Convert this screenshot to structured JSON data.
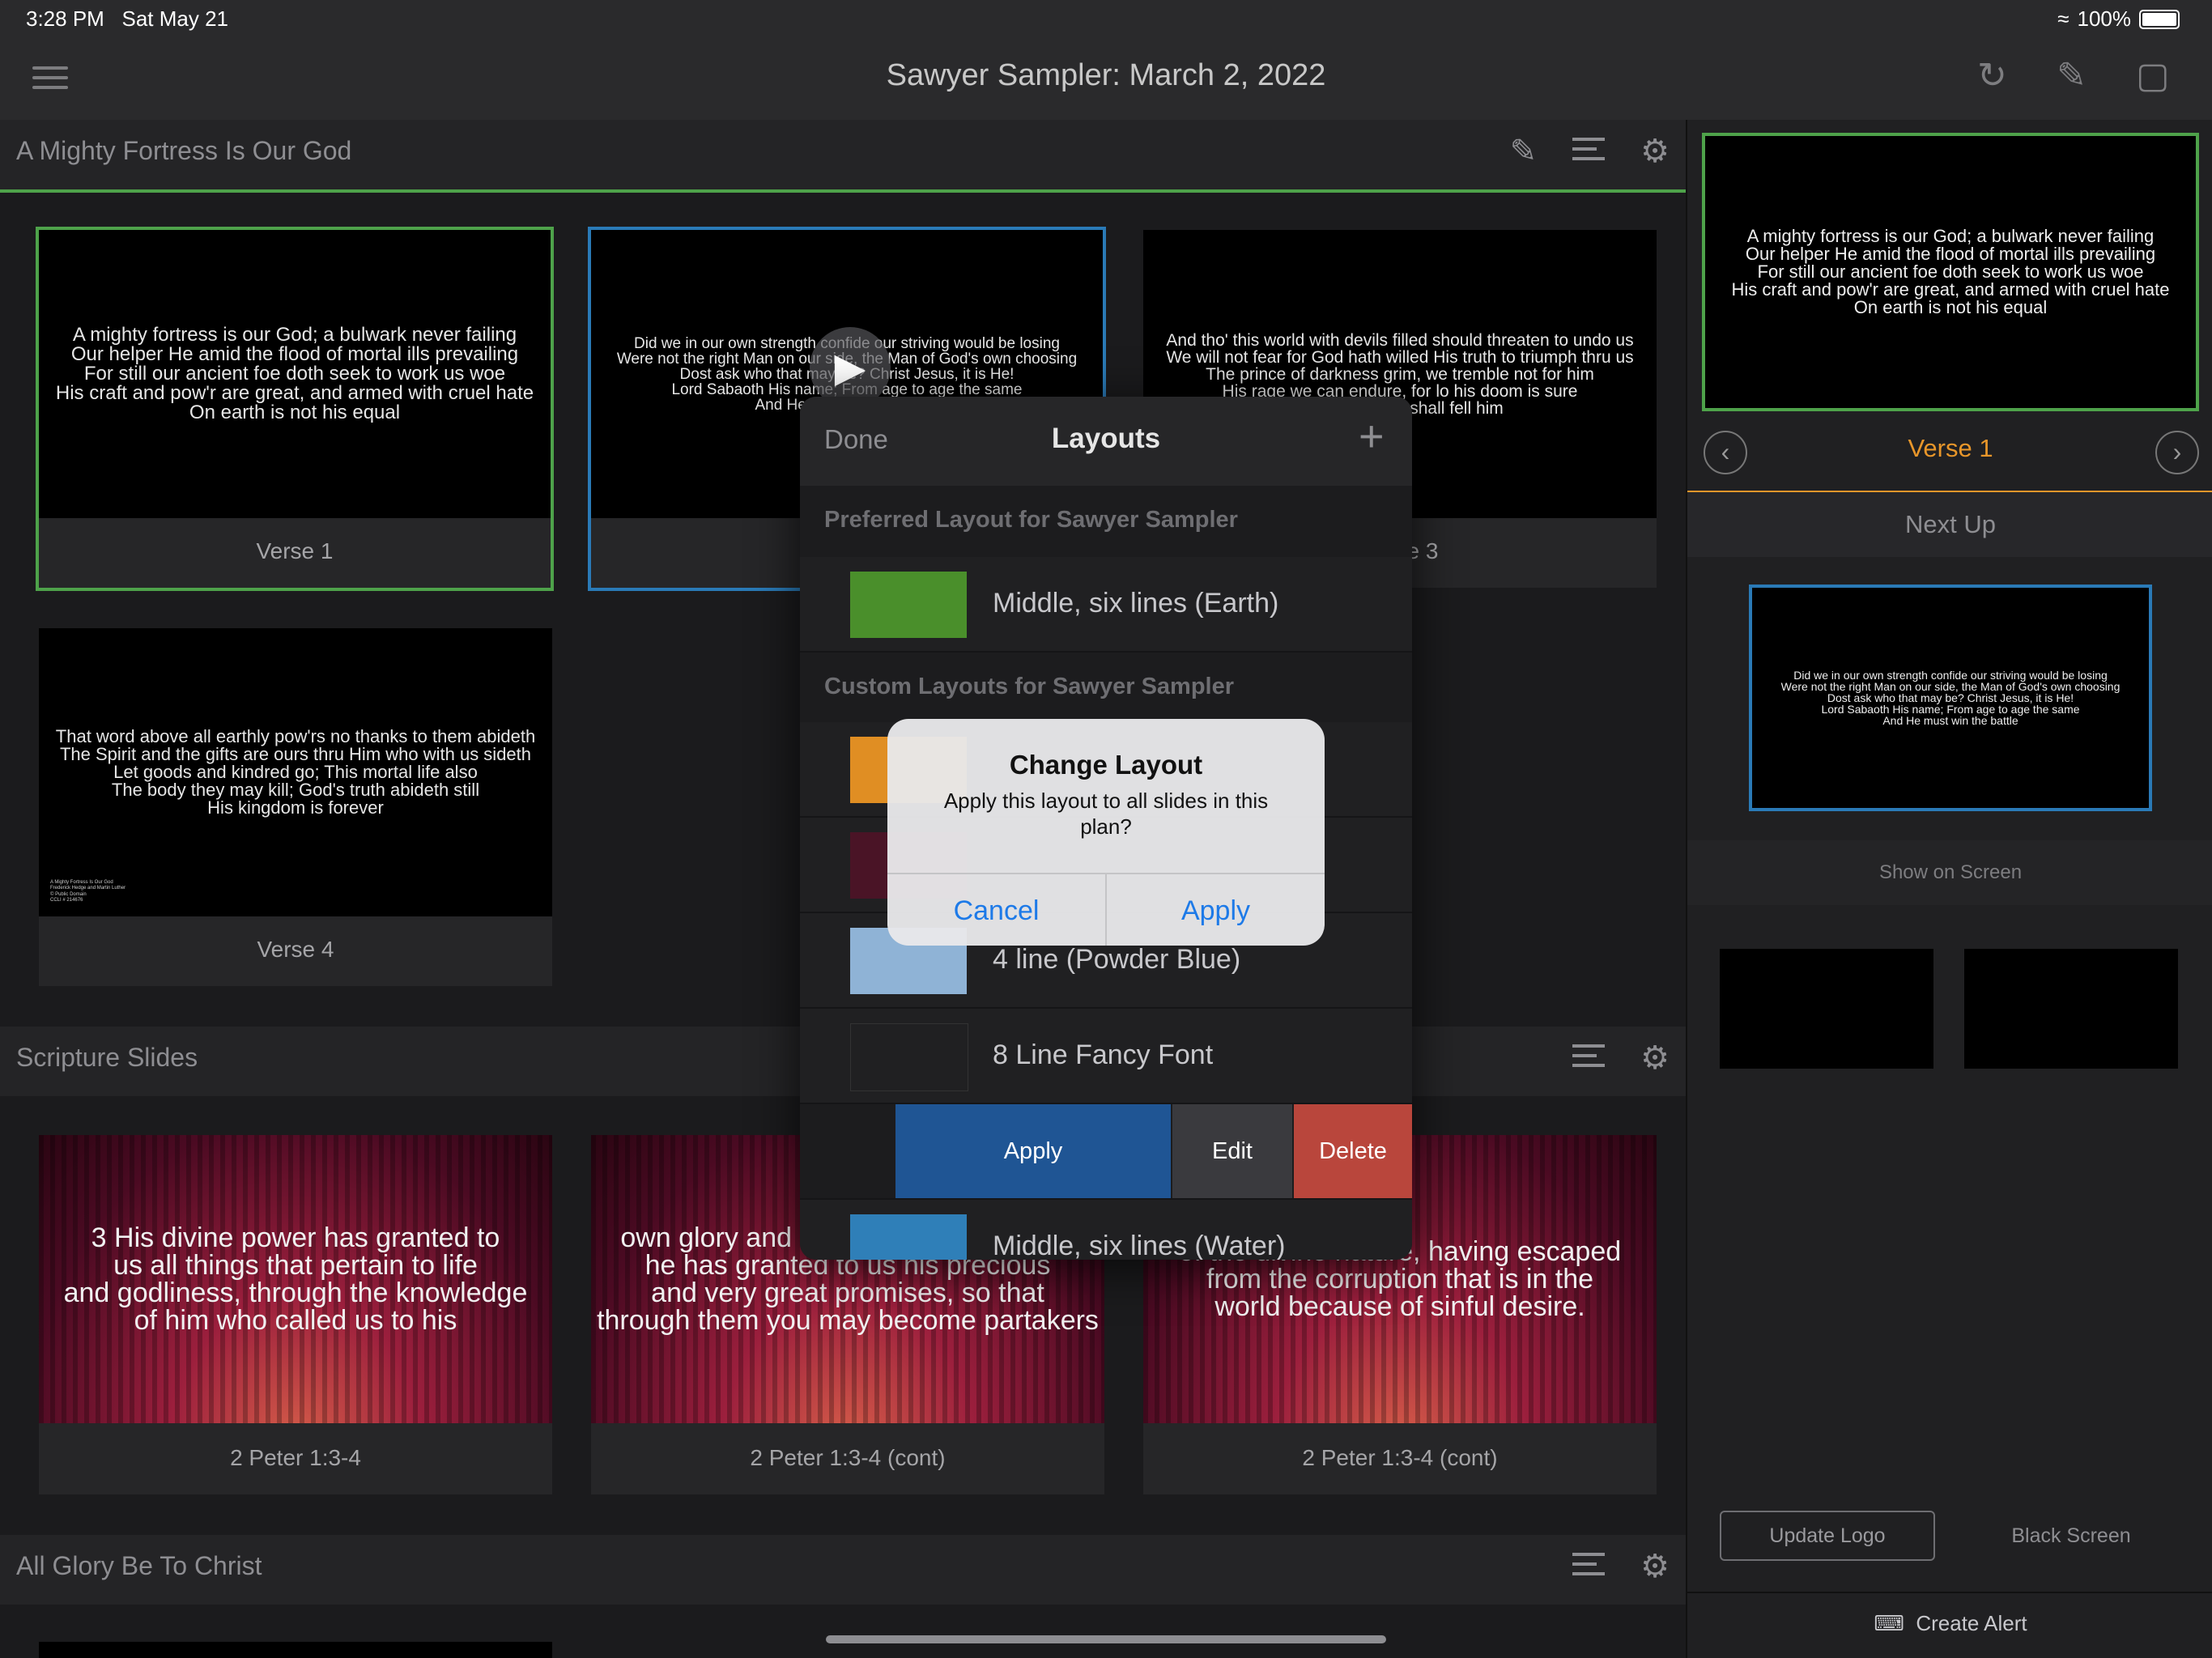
{
  "status": {
    "time": "3:28 PM",
    "date": "Sat May 21",
    "battery": "100%"
  },
  "nav": {
    "title": "Sawyer Sampler: March 2, 2022"
  },
  "sections": [
    {
      "title": "A Mighty Fortress Is Our God"
    },
    {
      "title": "Scripture Slides"
    },
    {
      "title": "All Glory Be To Christ"
    }
  ],
  "slides": [
    {
      "caption": "Verse 1",
      "text": "A mighty fortress is our God; a bulwark never failing\nOur helper He amid the flood of mortal ills prevailing\nFor still our ancient foe doth seek to work us woe\nHis craft and pow'r are great, and armed with cruel hate\nOn earth is not his equal"
    },
    {
      "caption": "Verse 2",
      "text": "Did we in our own strength confide our striving would be losing\nWere not the right Man on our side, the Man of God's own choosing\nDost ask who that may be? Christ Jesus, it is He!\nLord Sabaoth His name; From age to age the same\nAnd He must win the battle"
    },
    {
      "caption": "Verse 3",
      "text": "And tho' this world with devils filled should threaten to undo us\nWe will not fear for God hath willed His truth to triumph thru us\nThe prince of darkness grim, we tremble not for him\nHis rage we can endure, for lo his doom is sure\nOne little word shall fell him"
    },
    {
      "caption": "Verse 4",
      "text": "That word above all earthly pow'rs no thanks to them abideth\nThe Spirit and the gifts are ours thru Him who with us sideth\nLet goods and kindred go; This mortal life also\nThe body they may kill; God's truth abideth still\nHis kingdom is forever",
      "credit": "A Mighty Fortress Is Our God\nFrederick Hedge and Martin Luther\n© Public Domain\nCCLI # 214676"
    }
  ],
  "scripture": [
    {
      "caption": "2 Peter 1:3-4",
      "text": "3 His divine power has granted to\nus all things that pertain to life\nand godliness, through the knowledge\nof him who called us to his"
    },
    {
      "caption": "2 Peter 1:3-4 (cont)",
      "text": "own glory and excellence, 4 by which\nhe has granted to us his precious\nand very great promises, so that\nthrough them you may become partakers"
    },
    {
      "caption": "2 Peter 1:3-4 (cont)",
      "text": "of the divine nature, having escaped\nfrom the corruption that is in the\nworld because of sinful desire."
    }
  ],
  "right": {
    "current_text": "A mighty fortress is our God; a bulwark never failing\nOur helper He amid the flood of mortal ills prevailing\nFor still our ancient foe doth seek to work us woe\nHis craft and pow'r are great, and armed with cruel hate\nOn earth is not his equal",
    "current_label": "Verse 1",
    "next_up": "Next Up",
    "next_text": "Did we in our own strength confide our striving would be losing\nWere not the right Man on our side, the Man of God's own choosing\nDost ask who that may be? Christ Jesus, it is He!\nLord Sabaoth His name; From age to age the same\nAnd He must win the battle",
    "show_on_screen": "Show on Screen",
    "update_logo": "Update Logo",
    "black_screen": "Black Screen",
    "create_alert": "Create Alert"
  },
  "layouts": {
    "done": "Done",
    "title": "Layouts",
    "add": "+",
    "preferred_header": "Preferred Layout for Sawyer Sampler",
    "preferred": {
      "name": "Middle, six lines (Earth)",
      "color": "#4a8f2b"
    },
    "custom_header": "Custom Layouts for Sawyer Sampler",
    "items": [
      {
        "name": "",
        "color": "#e08e23"
      },
      {
        "name": "",
        "color": "#4a1426"
      },
      {
        "name": "4 line (Powder Blue)",
        "color": "#8fb3d6"
      },
      {
        "name": "8 Line Fancy Font",
        "color": "#202022"
      }
    ],
    "swipe": {
      "apply": "Apply",
      "edit": "Edit",
      "delete": "Delete"
    },
    "last": {
      "name": "Middle, six lines (Water)",
      "color": "#2f7fb8"
    }
  },
  "alert": {
    "title": "Change Layout",
    "message": "Apply this layout to all slides in this plan?",
    "cancel": "Cancel",
    "apply": "Apply"
  }
}
